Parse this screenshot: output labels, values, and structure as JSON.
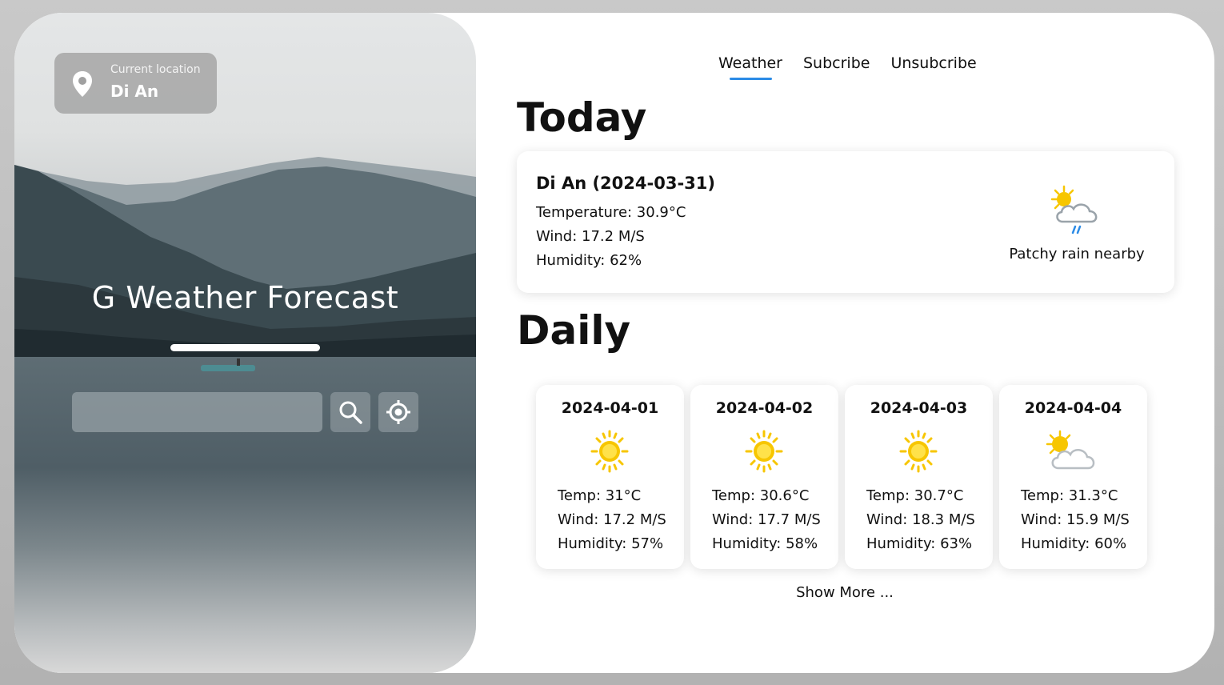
{
  "location": {
    "label": "Current location",
    "value": "Di An",
    "icon": "pin-icon"
  },
  "hero": {
    "title": "G Weather Forecast"
  },
  "search": {
    "placeholder": "",
    "search_icon": "search-icon",
    "locate_icon": "crosshair-icon"
  },
  "nav": {
    "tabs": [
      {
        "label": "Weather",
        "active": true
      },
      {
        "label": "Subcribe"
      },
      {
        "label": "Unsubcribe"
      }
    ]
  },
  "today": {
    "heading": "Today",
    "place": "Di An (2024-03-31)",
    "temperature": "Temperature: 30.9°C",
    "wind": "Wind: 17.2 M/S",
    "humidity": "Humidity: 62%",
    "condition": "Patchy rain nearby",
    "icon": "sun-cloud-rain-icon"
  },
  "daily": {
    "heading": "Daily",
    "days": [
      {
        "date": "2024-04-01",
        "icon": "sun-icon",
        "temp": "Temp: 31°C",
        "wind": "Wind: 17.2 M/S",
        "humidity": "Humidity: 57%"
      },
      {
        "date": "2024-04-02",
        "icon": "sun-icon",
        "temp": "Temp: 30.6°C",
        "wind": "Wind: 17.7 M/S",
        "humidity": "Humidity: 58%"
      },
      {
        "date": "2024-04-03",
        "icon": "sun-icon",
        "temp": "Temp: 30.7°C",
        "wind": "Wind: 18.3 M/S",
        "humidity": "Humidity: 63%"
      },
      {
        "date": "2024-04-04",
        "icon": "sun-cloud-icon",
        "temp": "Temp: 31.3°C",
        "wind": "Wind: 15.9 M/S",
        "humidity": "Humidity: 60%"
      }
    ],
    "show_more": "Show More ..."
  },
  "colors": {
    "accent": "#2b8be6",
    "sun": "#f7c600",
    "cloud": "#9aa3aa"
  }
}
